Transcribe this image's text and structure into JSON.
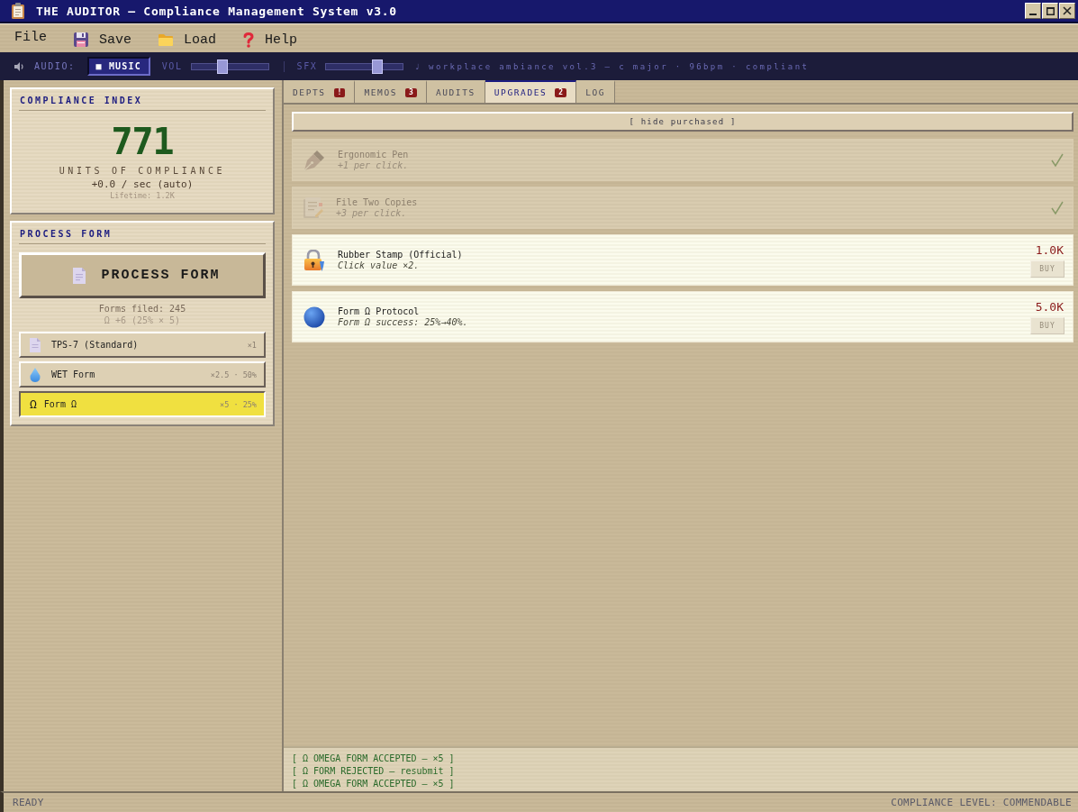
{
  "window": {
    "title": "THE AUDITOR — Compliance Management System v3.0"
  },
  "menu": [
    {
      "label": "File"
    },
    {
      "label": "Save"
    },
    {
      "label": "Load"
    },
    {
      "label": "Help"
    }
  ],
  "audio": {
    "label": "AUDIO:",
    "music": {
      "label": "■ MUSIC",
      "on": true
    },
    "volume": {
      "label": "VOL",
      "level": 0.4
    },
    "sfx": {
      "label": "SFX",
      "level": 0.66
    },
    "now_playing": "♩ workplace ambiance vol.3 — c major · 96bpm · compliant"
  },
  "compliance": {
    "title": "COMPLIANCE INDEX",
    "value": "771",
    "unit": "UNITS OF COMPLIANCE",
    "rate": "+0.0 / sec (auto)",
    "lifetime": "Lifetime: 1.2K"
  },
  "process": {
    "title": "PROCESS FORM",
    "button": "PROCESS FORM",
    "filed": "Forms filed: 245",
    "omega": "Ω +6 (25% × 5)",
    "forms": [
      {
        "kind": "document",
        "name": "TPS-7 (Standard)",
        "stats": "×1",
        "selected": false
      },
      {
        "kind": "drop",
        "name": "WET Form",
        "stats": "×2.5 · 50%",
        "selected": false
      },
      {
        "kind": "glyph",
        "glyph": "Ω",
        "name": "Form Ω",
        "stats": "×5 · 25%",
        "selected": true
      }
    ]
  },
  "tabs": [
    {
      "label": "DEPTS",
      "badge": "!",
      "selected": false
    },
    {
      "label": "MEMOS",
      "badge": "3",
      "selected": false
    },
    {
      "label": "AUDITS",
      "selected": false
    },
    {
      "label": "UPGRADES",
      "badge": "2",
      "selected": true
    },
    {
      "label": "LOG",
      "selected": false
    }
  ],
  "upgrades": {
    "filter_button": "[ hide purchased ]",
    "items": [
      {
        "name": "Ergonomic Pen",
        "description": "+1 per click.",
        "purchased": true
      },
      {
        "name": "File Two Copies",
        "description": "+3 per click.",
        "purchased": true
      },
      {
        "name": "Rubber Stamp (Official)",
        "description": "Click value ×2.",
        "purchased": false,
        "price": "1.0K",
        "buy": {
          "label": "BUY",
          "disabled": true
        }
      },
      {
        "name": "Form Ω Protocol",
        "description": "Form Ω success: 25%→40%.",
        "purchased": false,
        "price": "5.0K",
        "buy": {
          "label": "BUY",
          "disabled": true
        }
      }
    ]
  },
  "log": [
    "[ Ω OMEGA FORM ACCEPTED — ×5 ]",
    "[ Ω FORM REJECTED — resubmit ]",
    "[ Ω OMEGA FORM ACCEPTED — ×5 ]"
  ],
  "status_bar": {
    "left": "READY",
    "right": "COMPLIANCE LEVEL: COMMENDABLE"
  }
}
